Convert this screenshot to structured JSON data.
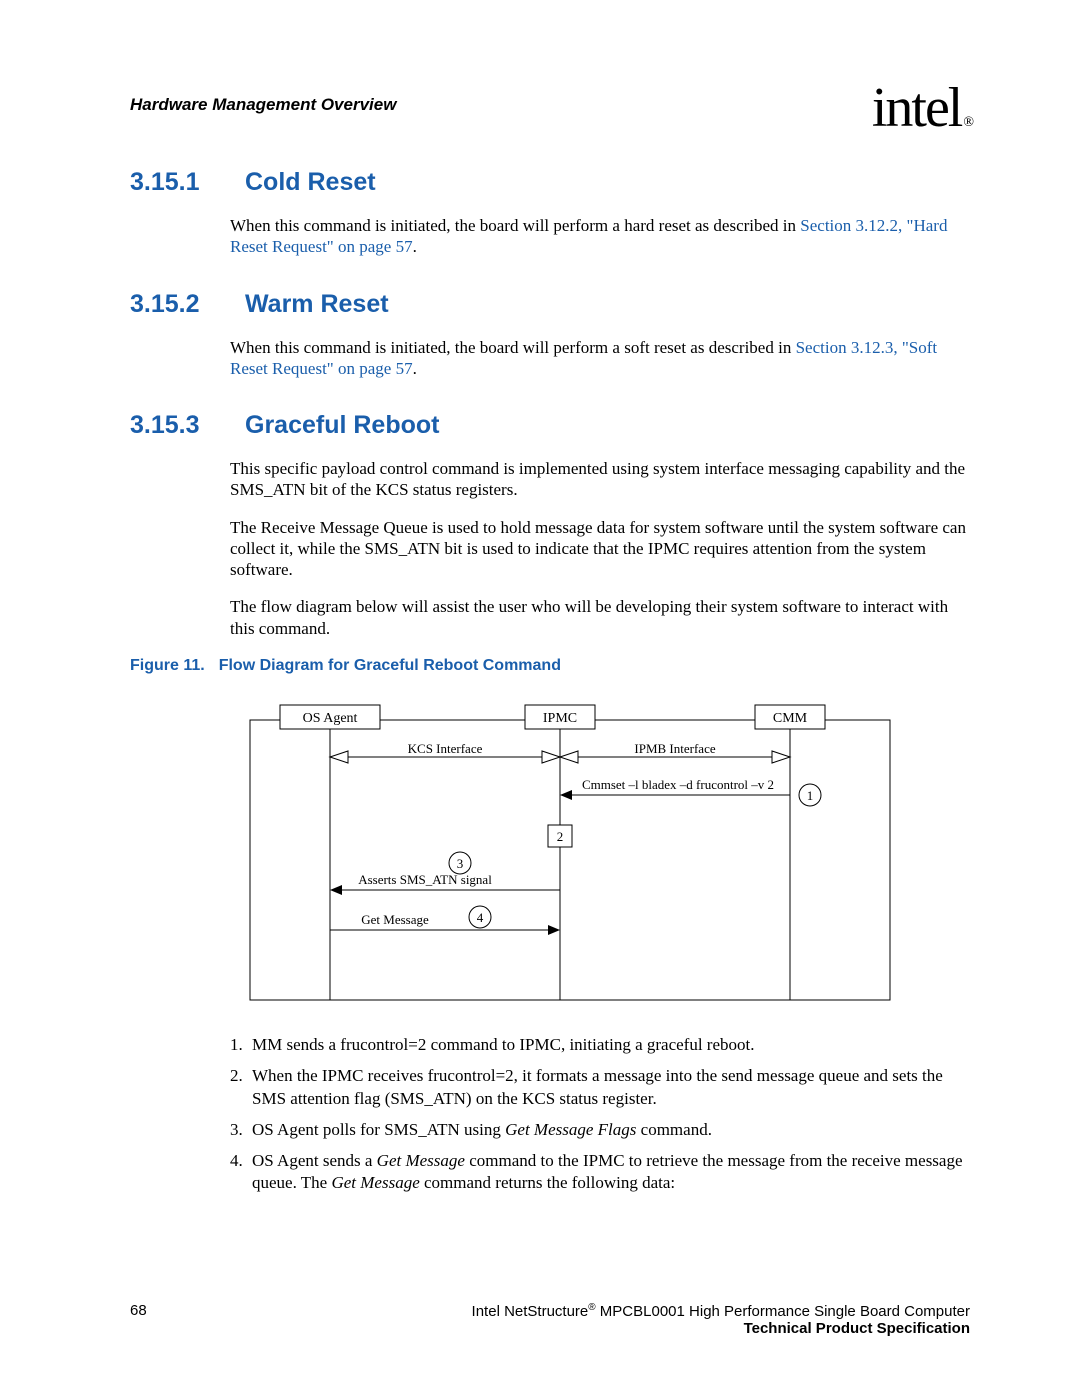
{
  "header": {
    "doc_section": "Hardware Management Overview",
    "logo_text": "intel",
    "logo_reg": "®"
  },
  "sections": {
    "s1": {
      "num": "3.15.1",
      "title": "Cold Reset",
      "p1a": "When this command is initiated, the board will perform a hard reset as described in ",
      "p1link": "Section 3.12.2, \"Hard Reset Request\" on page 57",
      "p1b": "."
    },
    "s2": {
      "num": "3.15.2",
      "title": "Warm Reset",
      "p1a": "When this command is initiated, the board will perform a soft reset as described in ",
      "p1link": "Section 3.12.3, \"Soft Reset Request\" on page 57",
      "p1b": "."
    },
    "s3": {
      "num": "3.15.3",
      "title": "Graceful Reboot",
      "p1": "This specific payload control command is implemented using system interface messaging capability and the SMS_ATN bit of the KCS status registers.",
      "p2": "The Receive Message Queue is used to hold message data for system software until the system software can collect it, while the SMS_ATN bit is used to indicate that the IPMC requires attention from the system software.",
      "p3": "The flow diagram below will assist the user who will be developing their system software to interact with this command."
    }
  },
  "figure": {
    "label": "Figure 11.",
    "title": "Flow Diagram for Graceful Reboot Command",
    "actors": {
      "os": "OS Agent",
      "ipmc": "IPMC",
      "cmm": "CMM"
    },
    "labels": {
      "kcs": "KCS Interface",
      "ipmb": "IPMB Interface",
      "cmd": "Cmmset –l bladex –d frucontrol –v 2",
      "assert": "Asserts SMS_ATN signal",
      "getmsg": "Get Message"
    },
    "steps": {
      "n1": "1",
      "n2": "2",
      "n3": "3",
      "n4": "4"
    }
  },
  "list": {
    "i1": {
      "n": "1.",
      "t": "MM sends a frucontrol=2 command to IPMC, initiating a graceful reboot."
    },
    "i2": {
      "n": "2.",
      "t": "When the IPMC receives frucontrol=2, it formats a message into the send message queue and sets the SMS attention flag (SMS_ATN) on the KCS status register."
    },
    "i3": {
      "n": "3.",
      "ta": "OS Agent polls for SMS_ATN using ",
      "ti": "Get Message Flags",
      "tb": " command."
    },
    "i4": {
      "n": "4.",
      "ta": "OS Agent sends a ",
      "ti1": "Get Message",
      "tb": " command to the IPMC to retrieve the message from the receive message queue. The ",
      "ti2": "Get Message",
      "tc": " command returns the following data:"
    }
  },
  "footer": {
    "page": "68",
    "line1a": "Intel NetStructure",
    "line1b": " MPCBL0001 High Performance Single Board Computer",
    "line2": "Technical Product Specification",
    "reg": "®"
  }
}
